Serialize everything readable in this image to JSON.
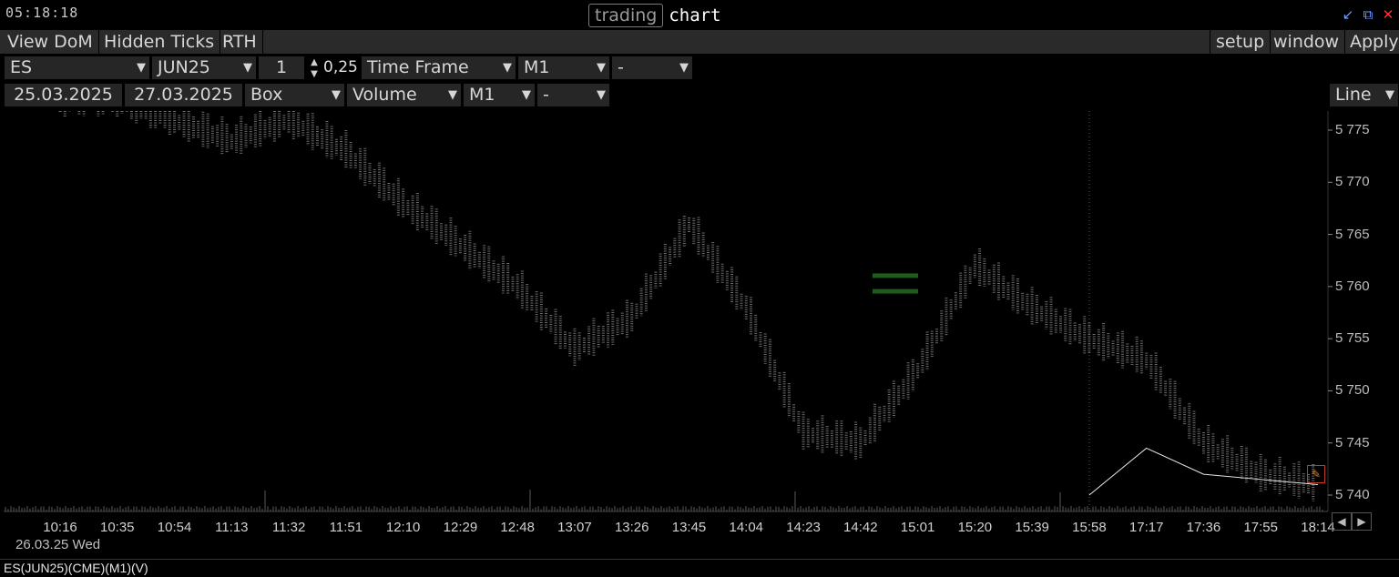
{
  "titlebar": {
    "clock": "05:18:18",
    "brand_boxed": "trading",
    "brand_word": "chart",
    "icons": [
      "minimize-icon",
      "restore-icon",
      "close-icon"
    ]
  },
  "menubar": {
    "left": [
      "View DoM",
      "Hidden Ticks",
      "RTH"
    ],
    "right": [
      "setup",
      "window",
      "Apply"
    ]
  },
  "controls_row1": {
    "symbol": "ES",
    "contract": "JUN25",
    "multiplier": "1",
    "tick_size": "0,25",
    "timeframe_label": "Time Frame",
    "timeframe": "M1",
    "extra": "-"
  },
  "controls_row2": {
    "date_from": "25.03.2025",
    "date_to": "27.03.2025",
    "chart_style": "Box",
    "indicator": "Volume",
    "indicator_tf": "M1",
    "indicator_extra": "-",
    "line_mode": "Line"
  },
  "chart_data": {
    "type": "line",
    "y_ticks": [
      "5 775",
      "5 770",
      "5 765",
      "5 760",
      "5 755",
      "5 750",
      "5 745",
      "5 740"
    ],
    "ylim": [
      5738,
      5777
    ],
    "x_ticks": [
      "10:16",
      "10:35",
      "10:54",
      "11:13",
      "11:32",
      "11:51",
      "12:10",
      "12:29",
      "12:48",
      "13:07",
      "13:26",
      "13:45",
      "14:04",
      "14:23",
      "14:42",
      "15:01",
      "15:20",
      "15:39",
      "15:58",
      "17:17",
      "17:36",
      "17:55",
      "18:14"
    ],
    "date_label": "26.03.25 Wed",
    "x_index": [
      0,
      1,
      2,
      3,
      4,
      5,
      6,
      7,
      8,
      9,
      10,
      11,
      12,
      13,
      14,
      15,
      16,
      17,
      18,
      19,
      20,
      21,
      22
    ],
    "price": [
      5778,
      5778,
      5776,
      5774,
      5776,
      5773,
      5768,
      5764,
      5760,
      5754,
      5757,
      5766,
      5758,
      5746,
      5745,
      5752,
      5762,
      5758,
      5755,
      5753,
      5745,
      5742,
      5741
    ],
    "overlay_line": [
      null,
      null,
      null,
      null,
      null,
      null,
      null,
      null,
      null,
      null,
      null,
      null,
      null,
      null,
      null,
      null,
      null,
      null,
      5740,
      5744.5,
      5742,
      5741.5,
      5741
    ],
    "highlight_levels": [
      5761,
      5759.5
    ],
    "session_break_index": 18
  },
  "statusbar": {
    "text": "ES(JUN25)(CME)(M1)(V)"
  }
}
